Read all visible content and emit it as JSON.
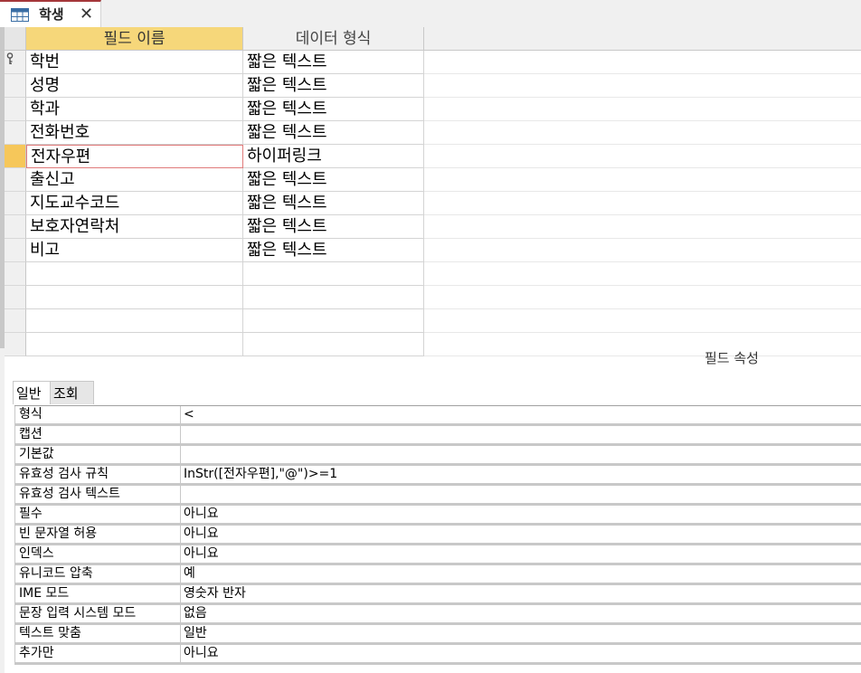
{
  "document_tab": {
    "title": "학생",
    "close_glyph": "✕",
    "icon": "table-icon"
  },
  "grid": {
    "columns": [
      "필드 이름",
      "데이터 형식"
    ],
    "rows": [
      {
        "name": "학번",
        "type": "짧은 텍스트",
        "primary_key": true
      },
      {
        "name": "성명",
        "type": "짧은 텍스트"
      },
      {
        "name": "학과",
        "type": "짧은 텍스트"
      },
      {
        "name": "전화번호",
        "type": "짧은 텍스트"
      },
      {
        "name": "전자우편",
        "type": "하이퍼링크",
        "selected": true
      },
      {
        "name": "출신고",
        "type": "짧은 텍스트"
      },
      {
        "name": "지도교수코드",
        "type": "짧은 텍스트"
      },
      {
        "name": "보호자연락처",
        "type": "짧은 텍스트"
      },
      {
        "name": "비고",
        "type": "짧은 텍스트"
      }
    ]
  },
  "properties": {
    "section_label": "필드 속성",
    "tabs": [
      "일반",
      "조회"
    ],
    "rows": [
      {
        "label": "형식",
        "value": "<"
      },
      {
        "label": "캡션",
        "value": ""
      },
      {
        "label": "기본값",
        "value": ""
      },
      {
        "label": "유효성 검사 규칙",
        "value": "InStr([전자우편],\"@\")>=1"
      },
      {
        "label": "유효성 검사 텍스트",
        "value": ""
      },
      {
        "label": "필수",
        "value": "아니요"
      },
      {
        "label": "빈 문자열 허용",
        "value": "아니요"
      },
      {
        "label": "인덱스",
        "value": "아니요"
      },
      {
        "label": "유니코드 압축",
        "value": "예"
      },
      {
        "label": "IME 모드",
        "value": "영숫자 반자"
      },
      {
        "label": "문장 입력 시스템 모드",
        "value": "없음"
      },
      {
        "label": "텍스트 맞춤",
        "value": "일반"
      },
      {
        "label": "추가만",
        "value": "아니요"
      }
    ]
  },
  "colors": {
    "accent": "#a4373a",
    "selected_header": "#f6d77a",
    "current_row_selector": "#f6c75a",
    "focus_border": "#e07a7a"
  }
}
